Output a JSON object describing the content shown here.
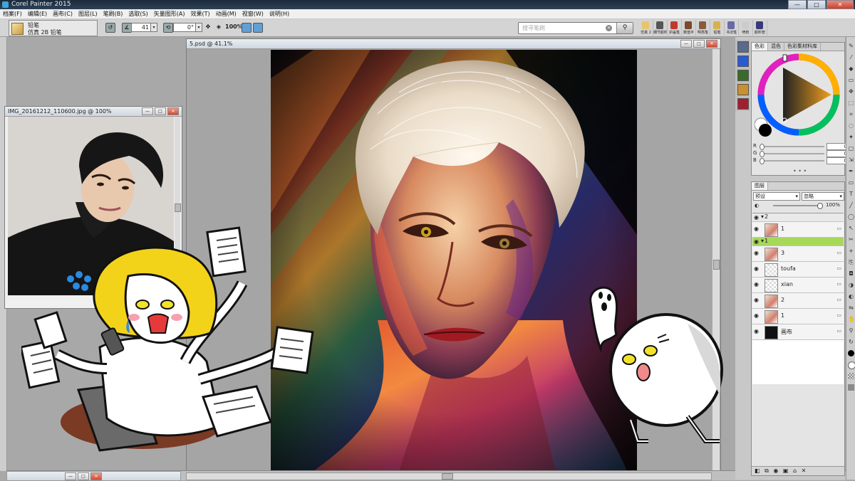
{
  "app": {
    "title": "Corel Painter 2015",
    "window_controls": {
      "minimize": "—",
      "maximize": "□",
      "close": "✕"
    }
  },
  "menu": [
    "档案(F)",
    "编辑(E)",
    "画布(C)",
    "图层(L)",
    "笔刷(B)",
    "选取(S)",
    "矢量图形(A)",
    "效果(T)",
    "动画(M)",
    "视窗(W)",
    "说明(H)"
  ],
  "brush_selector": {
    "category": "铅笔",
    "variant": "仿真 2B 铅笔"
  },
  "property_bar": {
    "angle_value": "41",
    "rotation_value": "0°",
    "zoom_label": "100%"
  },
  "search": {
    "placeholder": "搜寻笔刷"
  },
  "brush_strip": [
    {
      "label": "仿真 2",
      "color": "#e9c46a"
    },
    {
      "label": "细节颜料",
      "color": "#555555"
    },
    {
      "label": "护盖笔",
      "color": "#c0392b"
    },
    {
      "label": "数值平",
      "color": "#7a4a2a"
    },
    {
      "label": "明亮笔",
      "color": "#8a5a3a"
    },
    {
      "label": "铅笔",
      "color": "#d8b050"
    },
    {
      "label": "书法笔",
      "color": "#6a6aa8"
    },
    {
      "label": "喷枪",
      "color": "#cccccc"
    },
    {
      "label": "颜料管",
      "color": "#3a3a7a"
    }
  ],
  "reference_window": {
    "title": "IMG_20161212_110600.jpg @ 100%"
  },
  "canvas_window": {
    "title": "5.psd @ 41.1%"
  },
  "color_panel": {
    "tabs": [
      "色彩",
      "混色",
      "色彩集材料库"
    ],
    "sliders": [
      {
        "label": "R",
        "value": "0"
      },
      {
        "label": "G",
        "value": "0"
      },
      {
        "label": "B",
        "value": "0"
      }
    ],
    "accent": "#f0a020"
  },
  "layers_panel": {
    "tab": "图层",
    "composite_method": "预设",
    "preserve": "忽略",
    "opacity": "100%",
    "layers": [
      {
        "name": "2",
        "kind": "group"
      },
      {
        "name": "1",
        "kind": "layer"
      },
      {
        "name": "1",
        "kind": "group",
        "selected": true
      },
      {
        "name": "3",
        "kind": "layer"
      },
      {
        "name": "toufa",
        "kind": "layer"
      },
      {
        "name": "xian",
        "kind": "layer"
      },
      {
        "name": "2",
        "kind": "layer"
      },
      {
        "name": "1",
        "kind": "layer"
      },
      {
        "name": "画布",
        "kind": "canvas"
      }
    ]
  }
}
